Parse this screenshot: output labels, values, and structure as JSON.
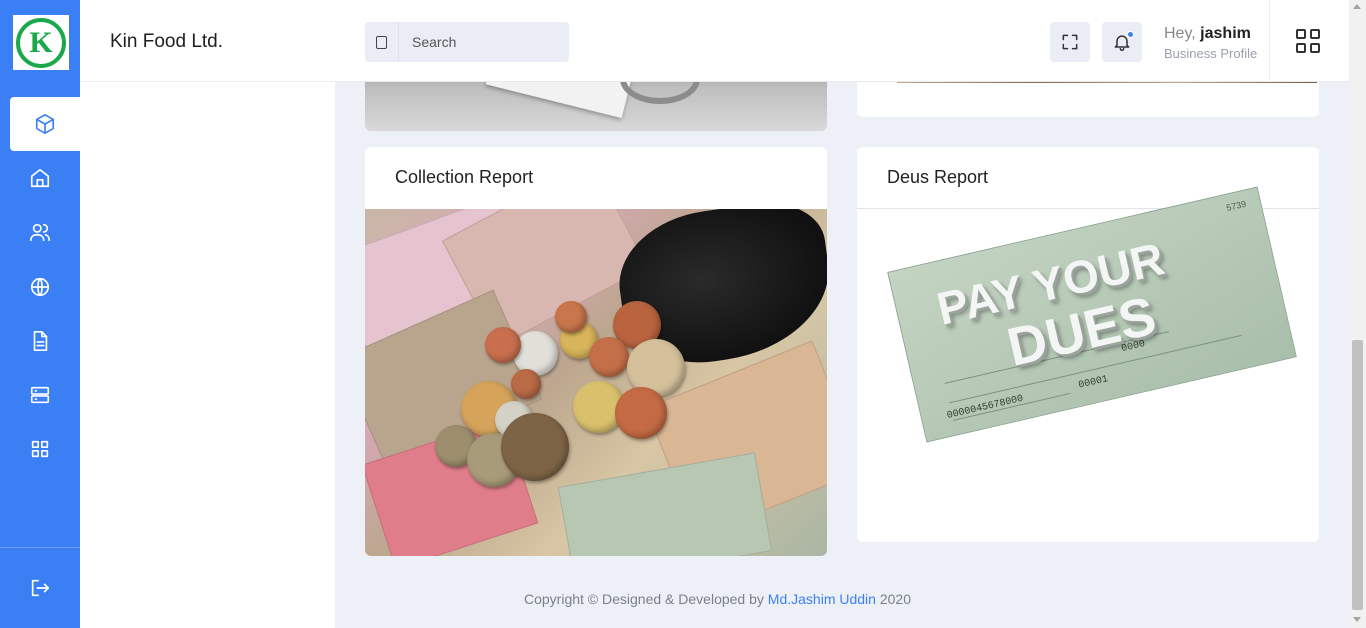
{
  "app": {
    "brand": "Kin Food Ltd.",
    "logo_letter": "K"
  },
  "rail": {
    "items": [
      {
        "icon": "box-icon",
        "active": true
      },
      {
        "icon": "home-icon"
      },
      {
        "icon": "users-icon"
      },
      {
        "icon": "globe-icon"
      },
      {
        "icon": "document-icon"
      },
      {
        "icon": "server-icon"
      },
      {
        "icon": "grid-icon"
      }
    ],
    "logout_icon": "logout-icon"
  },
  "header": {
    "search_placeholder": "Search",
    "greeting_prefix": "Hey,",
    "user_name": "jashim",
    "user_role": "Business Profile"
  },
  "cards": [
    {
      "title": "Collection Report",
      "image": "money"
    },
    {
      "title": "Deus Report",
      "image": "pay-your-dues-check"
    }
  ],
  "dues_image": {
    "line1": "PAY YOUR",
    "line2": "DUES",
    "check_number": "5739",
    "amount": "0000",
    "account": "0000045678000",
    "routing": "00001"
  },
  "footer": {
    "text": "Copyright © Designed & Developed by",
    "author": "Md.Jashim Uddin",
    "year": "2020"
  },
  "colors": {
    "accent": "#3b7ff5",
    "logo_green": "#1aa84a",
    "page_bg": "#eef0f8"
  }
}
